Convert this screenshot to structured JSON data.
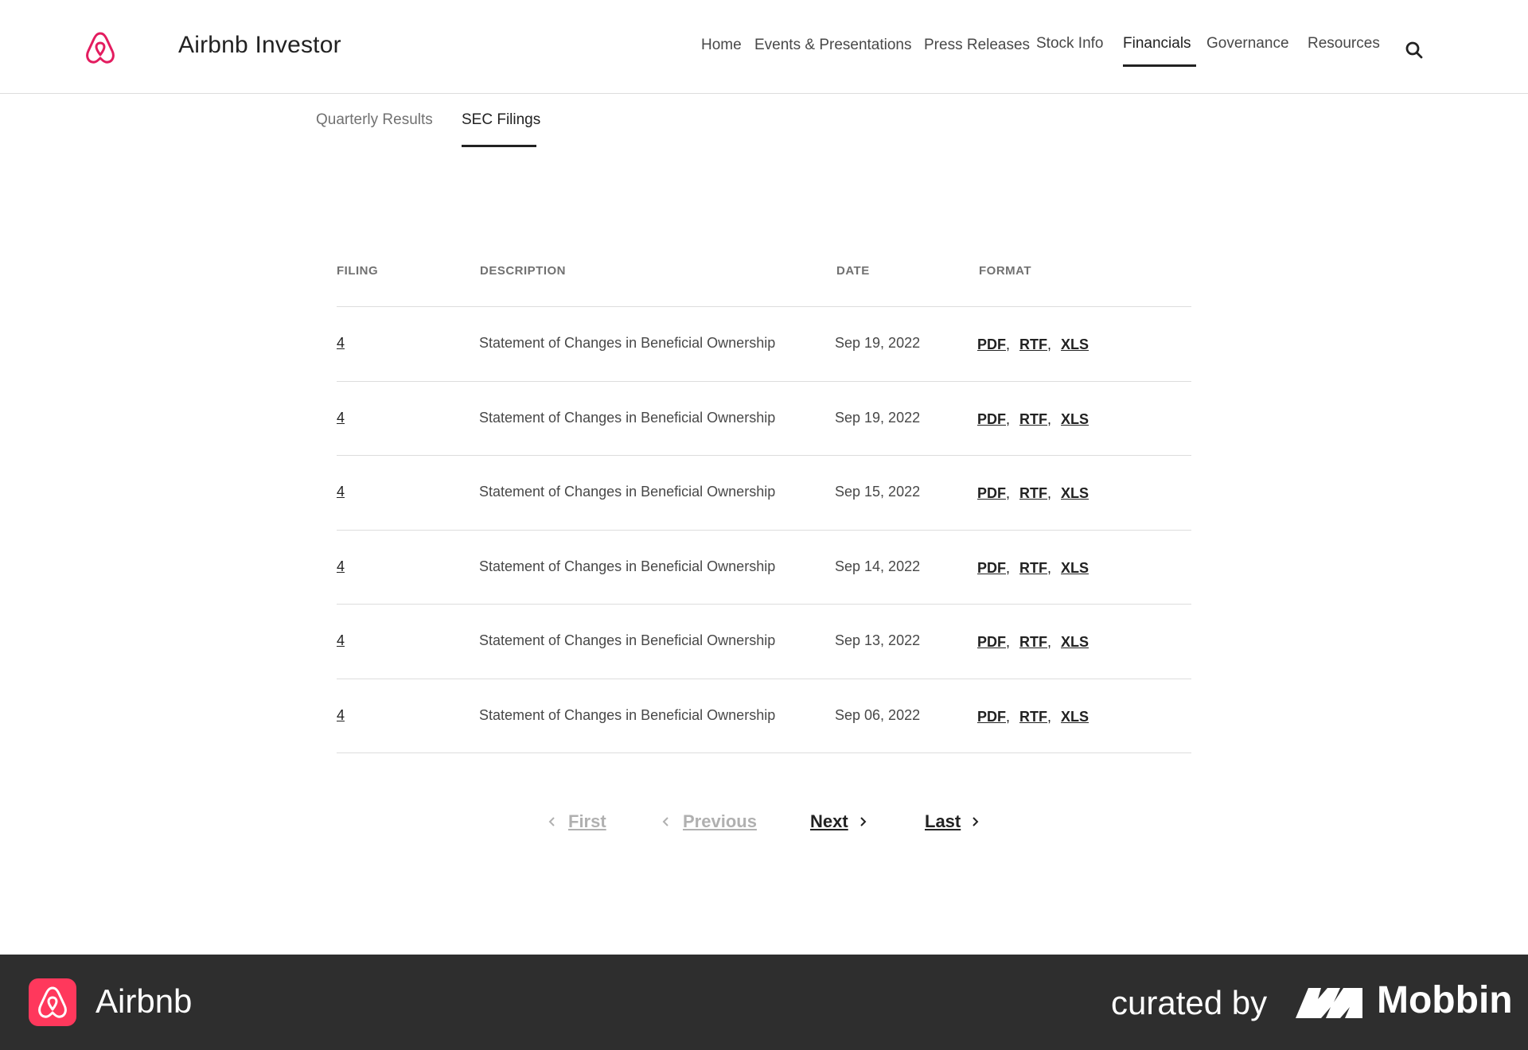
{
  "header": {
    "title": "Airbnb Investor",
    "brand_color": "#e31c5f",
    "nav": [
      {
        "label": "Home"
      },
      {
        "label": "Events & Presentations"
      },
      {
        "label": "Press Releases"
      },
      {
        "label": "Stock Info"
      },
      {
        "label": "Financials",
        "active": true
      },
      {
        "label": "Governance"
      },
      {
        "label": "Resources"
      }
    ],
    "search_icon": "search-icon"
  },
  "tabs": [
    {
      "label": "Quarterly Results",
      "active": false
    },
    {
      "label": "SEC Filings",
      "active": true
    }
  ],
  "table": {
    "columns": [
      "FILING",
      "DESCRIPTION",
      "DATE",
      "FORMAT"
    ],
    "rows": [
      {
        "filing": "4",
        "description": "Statement of Changes in Beneficial Ownership",
        "date": "Sep 19, 2022",
        "formats": [
          "PDF",
          "RTF",
          "XLS"
        ]
      },
      {
        "filing": "4",
        "description": "Statement of Changes in Beneficial Ownership",
        "date": "Sep 19, 2022",
        "formats": [
          "PDF",
          "RTF",
          "XLS"
        ]
      },
      {
        "filing": "4",
        "description": "Statement of Changes in Beneficial Ownership",
        "date": "Sep 15, 2022",
        "formats": [
          "PDF",
          "RTF",
          "XLS"
        ]
      },
      {
        "filing": "4",
        "description": "Statement of Changes in Beneficial Ownership",
        "date": "Sep 14, 2022",
        "formats": [
          "PDF",
          "RTF",
          "XLS"
        ]
      },
      {
        "filing": "4",
        "description": "Statement of Changes in Beneficial Ownership",
        "date": "Sep 13, 2022",
        "formats": [
          "PDF",
          "RTF",
          "XLS"
        ]
      },
      {
        "filing": "4",
        "description": "Statement of Changes in Beneficial Ownership",
        "date": "Sep 06, 2022",
        "formats": [
          "PDF",
          "RTF",
          "XLS"
        ]
      }
    ]
  },
  "pagination": {
    "first": "First",
    "previous": "Previous",
    "next": "Next",
    "last": "Last",
    "disabled_color": "#b0b0b0"
  },
  "footer": {
    "app_name": "Airbnb",
    "curated_by": "curated by",
    "mobbin": "Mobbin",
    "background": "#2e2e2e",
    "app_icon_color": "#ff385c"
  }
}
